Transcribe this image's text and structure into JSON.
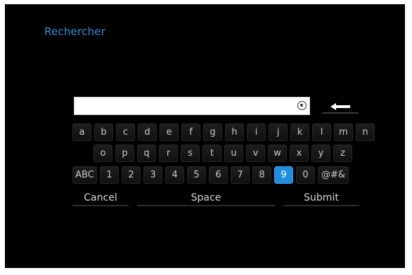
{
  "screen": {
    "title": "Rechercher"
  },
  "search": {
    "value": "",
    "placeholder": ""
  },
  "keyboard": {
    "row1": [
      "a",
      "b",
      "c",
      "d",
      "e",
      "f",
      "g",
      "h",
      "i",
      "j",
      "k",
      "l",
      "m",
      "n"
    ],
    "row2": [
      "o",
      "p",
      "q",
      "r",
      "s",
      "t",
      "u",
      "v",
      "w",
      "x",
      "y",
      "z"
    ],
    "row3": [
      "ABC",
      "1",
      "2",
      "3",
      "4",
      "5",
      "6",
      "7",
      "8",
      "9",
      "0",
      "@#&"
    ],
    "selected_key": "9"
  },
  "actions": {
    "cancel": "Cancel",
    "space": "Space",
    "submit": "Submit"
  },
  "colors": {
    "title": "#2f8fd8",
    "selected_key": "#1f8ee0",
    "background": "#000000"
  },
  "icons": {
    "clear": "clear-icon",
    "backspace": "backspace-arrow-icon"
  }
}
